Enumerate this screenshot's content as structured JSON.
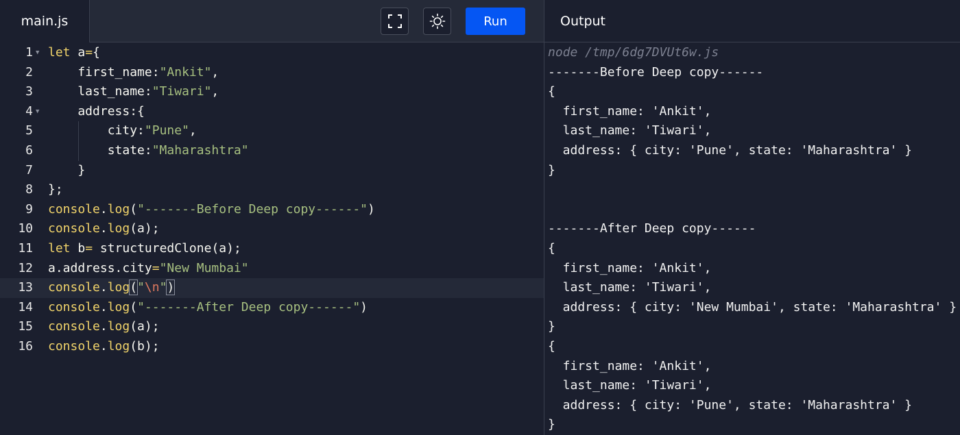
{
  "editor": {
    "file_tab": "main.js",
    "run_label": "Run",
    "icons": {
      "fullscreen": "fullscreen-icon",
      "theme": "sun-icon"
    },
    "lines": [
      {
        "n": "1",
        "fold": true,
        "segs": [
          [
            "kw",
            "let"
          ],
          [
            "plain",
            " a"
          ],
          [
            "kw",
            "="
          ],
          [
            "plain",
            "{"
          ]
        ]
      },
      {
        "n": "2",
        "segs": [
          [
            "plain",
            "    first_name:"
          ],
          [
            "str",
            "\"Ankit\""
          ],
          [
            "plain",
            ","
          ]
        ]
      },
      {
        "n": "3",
        "segs": [
          [
            "plain",
            "    last_name:"
          ],
          [
            "str",
            "\"Tiwari\""
          ],
          [
            "plain",
            ","
          ]
        ]
      },
      {
        "n": "4",
        "fold": true,
        "segs": [
          [
            "plain",
            "    address:{"
          ]
        ]
      },
      {
        "n": "5",
        "guide": true,
        "segs": [
          [
            "plain",
            "        city:"
          ],
          [
            "str",
            "\"Pune\""
          ],
          [
            "plain",
            ","
          ]
        ]
      },
      {
        "n": "6",
        "guide": true,
        "segs": [
          [
            "plain",
            "        state:"
          ],
          [
            "str",
            "\"Maharashtra\""
          ]
        ]
      },
      {
        "n": "7",
        "segs": [
          [
            "plain",
            "    }"
          ]
        ]
      },
      {
        "n": "8",
        "segs": [
          [
            "plain",
            "};"
          ]
        ]
      },
      {
        "n": "9",
        "segs": [
          [
            "kw",
            "console"
          ],
          [
            "plain",
            "."
          ],
          [
            "kw",
            "log"
          ],
          [
            "plain",
            "("
          ],
          [
            "str",
            "\"-------Before Deep copy------\""
          ],
          [
            "plain",
            ")"
          ]
        ]
      },
      {
        "n": "10",
        "segs": [
          [
            "kw",
            "console"
          ],
          [
            "plain",
            "."
          ],
          [
            "kw",
            "log"
          ],
          [
            "plain",
            "(a);"
          ]
        ]
      },
      {
        "n": "11",
        "segs": [
          [
            "kw",
            "let"
          ],
          [
            "plain",
            " b"
          ],
          [
            "kw",
            "="
          ],
          [
            "plain",
            " structuredClone(a);"
          ]
        ]
      },
      {
        "n": "12",
        "segs": [
          [
            "plain",
            "a.address.city"
          ],
          [
            "kw",
            "="
          ],
          [
            "str",
            "\"New Mumbai\""
          ]
        ]
      },
      {
        "n": "13",
        "active": true,
        "segs": [
          [
            "kw",
            "console"
          ],
          [
            "plain",
            "."
          ],
          [
            "kw",
            "log"
          ],
          [
            "plain",
            "(",
            true
          ],
          [
            "str",
            "\""
          ],
          [
            "esc",
            "\\n"
          ],
          [
            "str",
            "\""
          ],
          [
            "plain",
            ")",
            true
          ]
        ]
      },
      {
        "n": "14",
        "segs": [
          [
            "kw",
            "console"
          ],
          [
            "plain",
            "."
          ],
          [
            "kw",
            "log"
          ],
          [
            "plain",
            "("
          ],
          [
            "str",
            "\"-------After Deep copy------\""
          ],
          [
            "plain",
            ")"
          ]
        ]
      },
      {
        "n": "15",
        "segs": [
          [
            "kw",
            "console"
          ],
          [
            "plain",
            "."
          ],
          [
            "kw",
            "log"
          ],
          [
            "plain",
            "(a);"
          ]
        ]
      },
      {
        "n": "16",
        "segs": [
          [
            "kw",
            "console"
          ],
          [
            "plain",
            "."
          ],
          [
            "kw",
            "log"
          ],
          [
            "plain",
            "(b);"
          ]
        ]
      }
    ]
  },
  "output": {
    "title": "Output",
    "lines": [
      {
        "text": "node /tmp/6dg7DVUt6w.js",
        "cmd": true
      },
      {
        "text": "-------Before Deep copy------"
      },
      {
        "text": "{"
      },
      {
        "text": "  first_name: 'Ankit',"
      },
      {
        "text": "  last_name: 'Tiwari',"
      },
      {
        "text": "  address: { city: 'Pune', state: 'Maharashtra' }"
      },
      {
        "text": "}"
      },
      {
        "text": ""
      },
      {
        "text": ""
      },
      {
        "text": "-------After Deep copy------"
      },
      {
        "text": "{"
      },
      {
        "text": "  first_name: 'Ankit',"
      },
      {
        "text": "  last_name: 'Tiwari',"
      },
      {
        "text": "  address: { city: 'New Mumbai', state: 'Maharashtra' }"
      },
      {
        "text": "}"
      },
      {
        "text": "{"
      },
      {
        "text": "  first_name: 'Ankit',"
      },
      {
        "text": "  last_name: 'Tiwari',"
      },
      {
        "text": "  address: { city: 'Pune', state: 'Maharashtra' }"
      },
      {
        "text": "}"
      }
    ]
  },
  "colors": {
    "background": "#1b1f2e",
    "header": "#252a38",
    "run_button": "#0556f3",
    "keyword": "#f0d36a",
    "string": "#a7c080",
    "escape": "#e07a5f"
  }
}
